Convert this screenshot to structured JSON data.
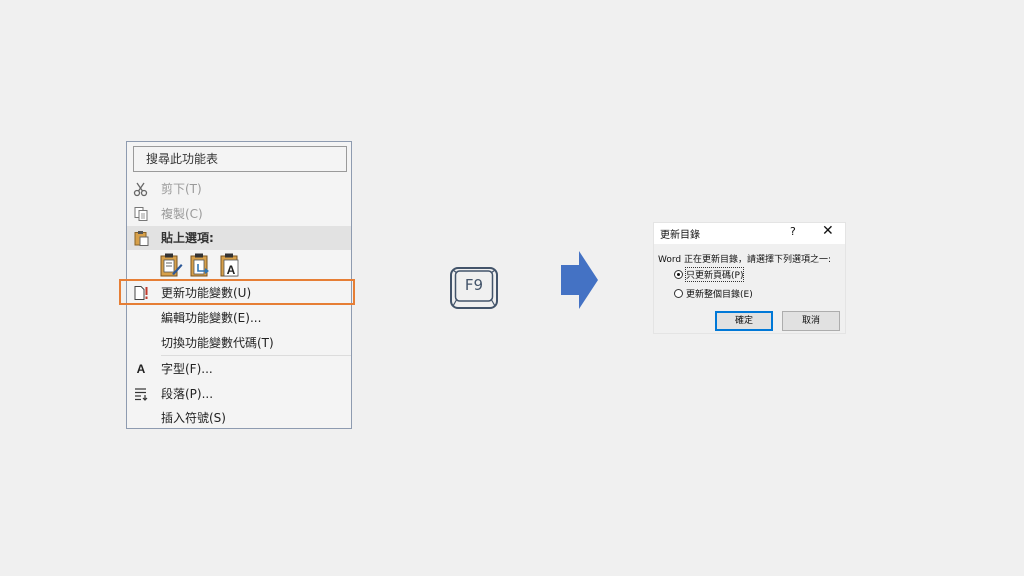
{
  "context_menu": {
    "search_label": "搜尋此功能表",
    "items": [
      {
        "label": "剪下(T)",
        "icon": "scissors-icon",
        "enabled": false
      },
      {
        "label": "複製(C)",
        "icon": "copy-icon",
        "enabled": false
      },
      {
        "label": "貼上選項:",
        "icon": "clipboard-icon",
        "header": true
      },
      {
        "label": "更新功能變數(U)",
        "icon": "update-field-icon",
        "highlighted": true
      },
      {
        "label": "編輯功能變數(E)...",
        "icon": "",
        "enabled": true
      },
      {
        "label": "切換功能變數代碼(T)",
        "icon": "",
        "enabled": true
      },
      {
        "label": "字型(F)...",
        "icon": "font-icon",
        "glyph": "A",
        "enabled": true
      },
      {
        "label": "段落(P)...",
        "icon": "paragraph-icon",
        "enabled": true
      },
      {
        "label": "插入符號(S)",
        "icon": "",
        "enabled": true
      }
    ],
    "paste_options": [
      "paste-keep-formatting-icon",
      "paste-merge-formatting-icon",
      "paste-text-only-icon"
    ],
    "highlight_color": "#e67e35"
  },
  "key": {
    "label": "F9",
    "color": "#43546a"
  },
  "arrow": {
    "color": "#4472c4"
  },
  "dialog": {
    "title": "更新目錄",
    "help": "?",
    "close": "✕",
    "message": "Word 正在更新目錄，請選擇下列選項之一:",
    "options": [
      {
        "label": "只更新頁碼(P)",
        "checked": true
      },
      {
        "label": "更新整個目錄(E)",
        "checked": false
      }
    ],
    "ok_label": "確定",
    "cancel_label": "取消",
    "accent": "#0078d7"
  }
}
